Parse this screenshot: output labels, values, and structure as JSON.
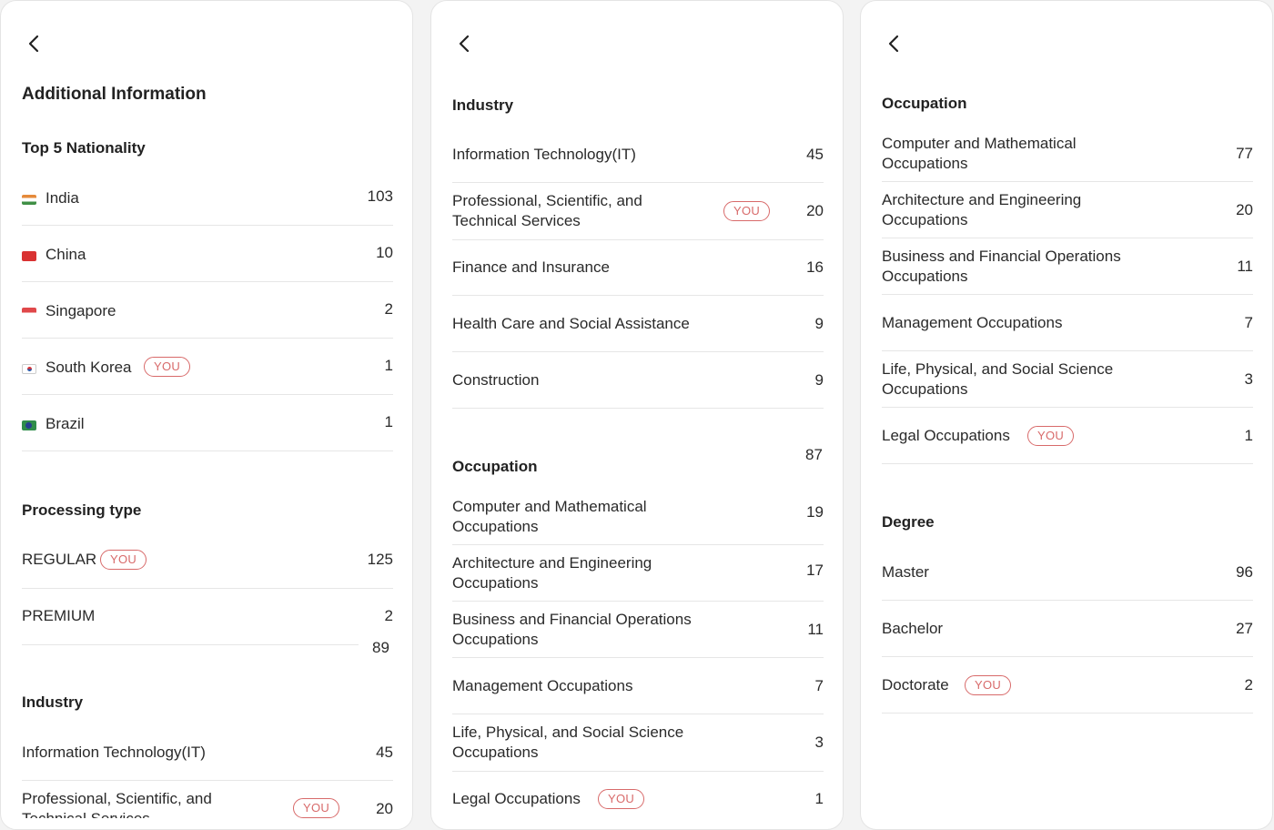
{
  "you_badge": "YOU",
  "panel1": {
    "title": "Additional Information",
    "nationality": {
      "heading": "Top 5 Nationality",
      "items": [
        {
          "flag": "india-flag-icon",
          "label": "India",
          "value": "103"
        },
        {
          "flag": "china-flag-icon",
          "label": "China",
          "value": "10"
        },
        {
          "flag": "singapore-flag-icon",
          "label": "Singapore",
          "value": "2"
        },
        {
          "flag": "south-korea-flag-icon",
          "label": "South Korea",
          "value": "1"
        },
        {
          "flag": "brazil-flag-icon",
          "label": "Brazil",
          "value": "1"
        }
      ]
    },
    "processing": {
      "heading": "Processing type",
      "items": [
        {
          "label": "REGULAR",
          "value": "125"
        },
        {
          "label": "PREMIUM",
          "value": "2"
        }
      ],
      "extra_value": "89"
    },
    "industry": {
      "heading": "Industry",
      "items": [
        {
          "label": "Information Technology(IT)",
          "value": "45"
        },
        {
          "label": "Professional, Scientific, and",
          "label2": "Technical Services",
          "value": "20"
        }
      ]
    }
  },
  "panel2": {
    "industry": {
      "heading": "Industry",
      "items": [
        {
          "label": "Information Technology(IT)",
          "value": "45"
        },
        {
          "label": "Professional, Scientific, and",
          "label2": "Technical Services",
          "value": "20"
        },
        {
          "label": "Finance and Insurance",
          "value": "16"
        },
        {
          "label": "Health Care and Social Assistance",
          "value": "9"
        },
        {
          "label": "Construction",
          "value": "9"
        }
      ]
    },
    "occupation": {
      "heading": "Occupation",
      "extra_value": "87",
      "items": [
        {
          "label": "Computer and Mathematical",
          "label2": "Occupations",
          "value": "19"
        },
        {
          "label": "Architecture and Engineering",
          "label2": "Occupations",
          "value": "17"
        },
        {
          "label": "Business and Financial Operations",
          "label2": "Occupations",
          "value": "11"
        },
        {
          "label": "Management Occupations",
          "value": "7"
        },
        {
          "label": "Life, Physical, and Social Science",
          "label2": "Occupations",
          "value": "3"
        },
        {
          "label": "Legal Occupations",
          "value": "1"
        }
      ]
    }
  },
  "panel3": {
    "occupation": {
      "heading": "Occupation",
      "items": [
        {
          "label": "Computer and Mathematical",
          "label2": "Occupations",
          "value": "77"
        },
        {
          "label": "Architecture and Engineering",
          "label2": "Occupations",
          "value": "20"
        },
        {
          "label": "Business and Financial Operations",
          "label2": "Occupations",
          "value": "11"
        },
        {
          "label": "Management Occupations",
          "value": "7"
        },
        {
          "label": "Life, Physical, and Social Science",
          "label2": "Occupations",
          "value": "3"
        },
        {
          "label": "Legal Occupations",
          "value": "1"
        }
      ]
    },
    "degree": {
      "heading": "Degree",
      "items": [
        {
          "label": "Master",
          "value": "96"
        },
        {
          "label": "Bachelor",
          "value": "27"
        },
        {
          "label": "Doctorate",
          "value": "2"
        }
      ]
    }
  },
  "colors": {
    "badge": "#d86a6a",
    "divider": "#e6e6e6",
    "text": "#222222"
  }
}
